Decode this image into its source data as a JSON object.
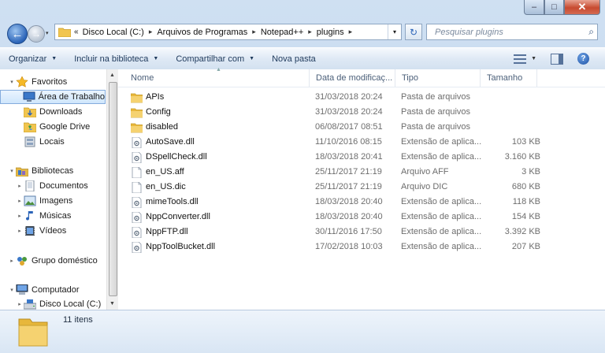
{
  "window": {
    "controls": {
      "minimize": "–",
      "maximize": "□",
      "close": "✕"
    }
  },
  "nav": {
    "back_glyph": "←",
    "forward_glyph": "→",
    "history_glyph": "▾",
    "breadcrumb_prefix": "«",
    "breadcrumbs": [
      "Disco Local (C:)",
      "Arquivos de Programas",
      "Notepad++",
      "plugins"
    ],
    "breadcrumb_sep": "▸",
    "address_drop": "▾",
    "refresh_glyph": "↻",
    "search_placeholder": "Pesquisar plugins",
    "search_icon": "⌕"
  },
  "toolbar": {
    "organize": "Organizar",
    "include_library": "Incluir na biblioteca",
    "share_with": "Compartilhar com",
    "new_folder": "Nova pasta",
    "dropdown_glyph": "▼",
    "help_glyph": "?"
  },
  "sidebar": {
    "items": [
      {
        "label": "Favoritos",
        "icon": "star-icon",
        "tog": "▾",
        "indent": 0
      },
      {
        "label": "Área de Trabalho",
        "icon": "desktop-icon",
        "tog": "",
        "indent": 1
      },
      {
        "label": "Downloads",
        "icon": "downloads-folder-icon",
        "tog": "",
        "indent": 1
      },
      {
        "label": "Google Drive",
        "icon": "google-drive-folder-icon",
        "tog": "",
        "indent": 1
      },
      {
        "label": "Locais",
        "icon": "recent-places-icon",
        "tog": "",
        "indent": 1
      },
      {
        "label": "Bibliotecas",
        "icon": "libraries-icon",
        "tog": "▾",
        "indent": 0
      },
      {
        "label": "Documentos",
        "icon": "documents-icon",
        "tog": "▸",
        "indent": 1
      },
      {
        "label": "Imagens",
        "icon": "pictures-icon",
        "tog": "▸",
        "indent": 1
      },
      {
        "label": "Músicas",
        "icon": "music-icon",
        "tog": "▸",
        "indent": 1
      },
      {
        "label": "Vídeos",
        "icon": "videos-icon",
        "tog": "▸",
        "indent": 1
      },
      {
        "label": "Grupo doméstico",
        "icon": "homegroup-icon",
        "tog": "▸",
        "indent": 0
      },
      {
        "label": "Computador",
        "icon": "computer-icon",
        "tog": "▾",
        "indent": 0
      },
      {
        "label": "Disco Local (C:)",
        "icon": "drive-icon",
        "tog": "▸",
        "indent": 1
      }
    ],
    "selected_index": 1
  },
  "columns": {
    "name": "Nome",
    "date": "Data de modificaç...",
    "type": "Tipo",
    "size": "Tamanho"
  },
  "files": [
    {
      "name": "APIs",
      "date": "31/03/2018 20:24",
      "type": "Pasta de arquivos",
      "size": "",
      "kind": "folder"
    },
    {
      "name": "Config",
      "date": "31/03/2018 20:24",
      "type": "Pasta de arquivos",
      "size": "",
      "kind": "folder"
    },
    {
      "name": "disabled",
      "date": "06/08/2017 08:51",
      "type": "Pasta de arquivos",
      "size": "",
      "kind": "folder"
    },
    {
      "name": "AutoSave.dll",
      "date": "11/10/2016 08:15",
      "type": "Extensão de aplica...",
      "size": "103 KB",
      "kind": "dll"
    },
    {
      "name": "DSpellCheck.dll",
      "date": "18/03/2018 20:41",
      "type": "Extensão de aplica...",
      "size": "3.160 KB",
      "kind": "dll"
    },
    {
      "name": "en_US.aff",
      "date": "25/11/2017 21:19",
      "type": "Arquivo AFF",
      "size": "3 KB",
      "kind": "file"
    },
    {
      "name": "en_US.dic",
      "date": "25/11/2017 21:19",
      "type": "Arquivo DIC",
      "size": "680 KB",
      "kind": "file"
    },
    {
      "name": "mimeTools.dll",
      "date": "18/03/2018 20:40",
      "type": "Extensão de aplica...",
      "size": "118 KB",
      "kind": "dll"
    },
    {
      "name": "NppConverter.dll",
      "date": "18/03/2018 20:40",
      "type": "Extensão de aplica...",
      "size": "154 KB",
      "kind": "dll"
    },
    {
      "name": "NppFTP.dll",
      "date": "30/11/2016 17:50",
      "type": "Extensão de aplica...",
      "size": "3.392 KB",
      "kind": "dll"
    },
    {
      "name": "NppToolBucket.dll",
      "date": "17/02/2018 10:03",
      "type": "Extensão de aplica...",
      "size": "207 KB",
      "kind": "dll"
    }
  ],
  "details": {
    "count": "11 itens"
  },
  "colors": {
    "folder": "#f1c54f",
    "selection": "#cfe6fc",
    "accent": "#2b64b8"
  }
}
